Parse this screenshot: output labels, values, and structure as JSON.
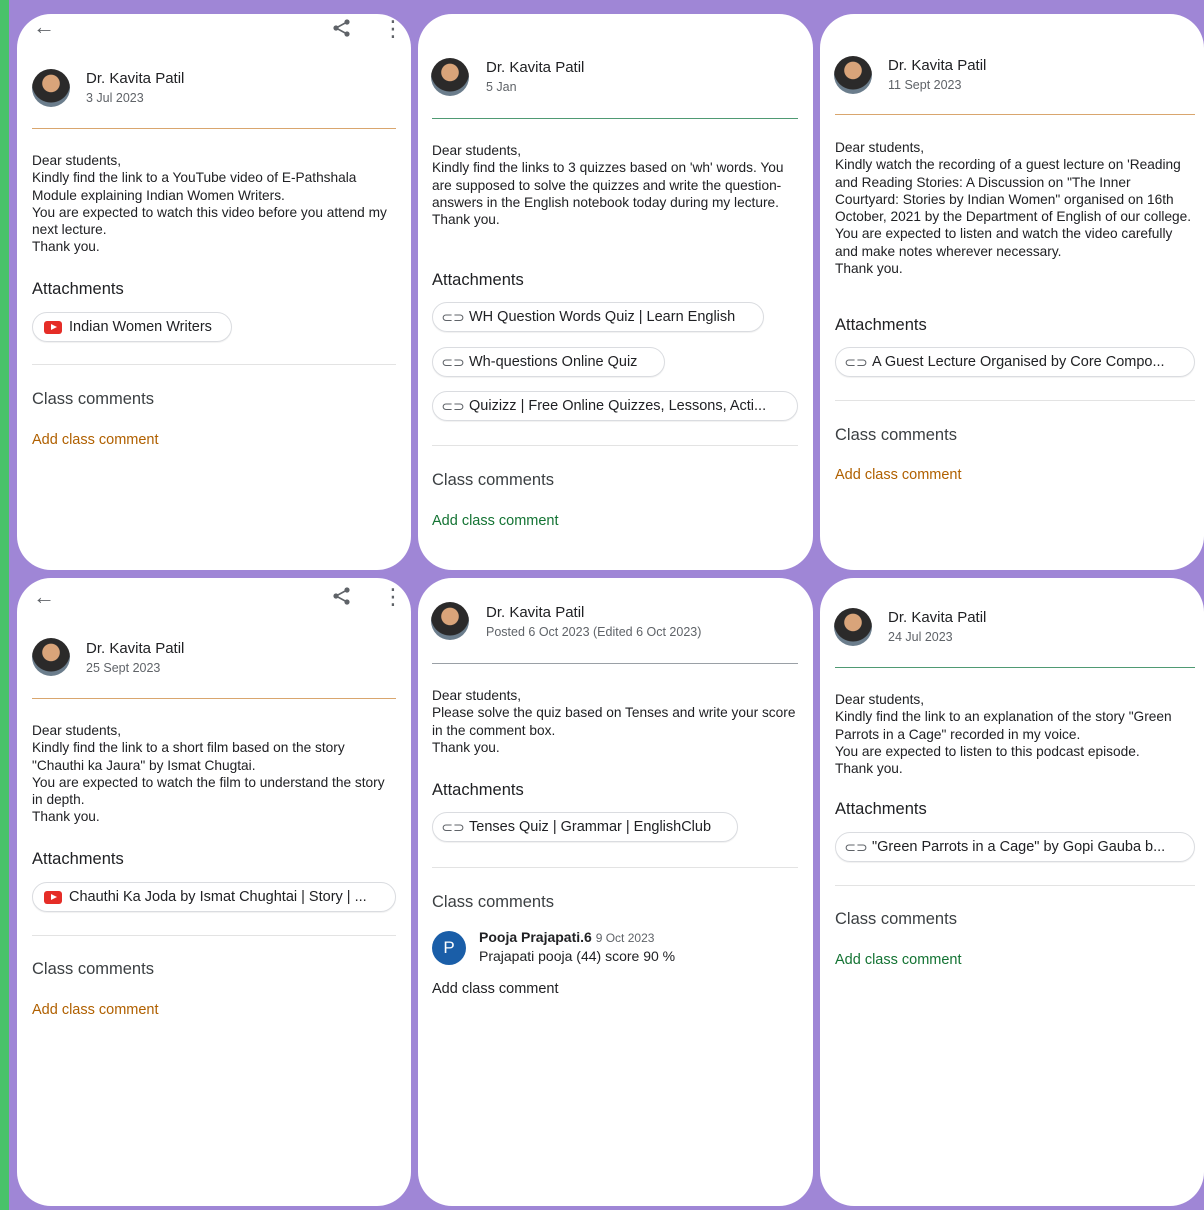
{
  "teacher": "Dr. Kavita Patil",
  "labels": {
    "attachments": "Attachments",
    "class_comments": "Class comments",
    "add_class_comment": "Add class comment"
  },
  "icons": {
    "back": "←",
    "share": "share-icon",
    "more": "⋮",
    "link": "⊂⊃"
  },
  "colors": {
    "background": "#9f86d6",
    "orange_accent": "#b06000",
    "green_accent": "#137333",
    "youtube_red": "#e52d27"
  },
  "posts": [
    {
      "date": "3 Jul 2023",
      "body": "Dear students,\nKindly find the link to a YouTube video of E-Pathshala Module explaining Indian Women Writers.\nYou are expected to watch this video before you attend my next lecture.\nThank you.",
      "attachments": [
        "Indian Women Writers"
      ]
    },
    {
      "date": "5 Jan",
      "body": "Dear students,\nKindly find the links to 3 quizzes based on 'wh' words. You are supposed to solve the quizzes and write the question-answers in the English notebook today during my lecture.\nThank you.",
      "attachments": [
        "WH Question Words Quiz | Learn English",
        "Wh-questions Online Quiz",
        "Quizizz | Free Online Quizzes, Lessons, Acti..."
      ]
    },
    {
      "date": "11 Sept 2023",
      "body": "Dear students,\nKindly watch the recording of a guest lecture on 'Reading and Reading Stories: A Discussion on \"The Inner Courtyard: Stories by Indian Women\" organised on 16th October, 2021 by the Department of English of our college.\nYou are expected to listen and watch the video carefully and make notes wherever necessary.\nThank you.",
      "attachments": [
        "A Guest Lecture Organised by Core Compo..."
      ]
    },
    {
      "date": "25 Sept 2023",
      "body": "Dear students,\nKindly find the link to a short film based on the story \"Chauthi ka Jaura\" by Ismat Chugtai.\nYou are expected to watch the film to understand the story in depth.\nThank you.",
      "attachments": [
        "Chauthi Ka Joda by Ismat Chughtai | Story | ..."
      ]
    },
    {
      "date": "Posted 6 Oct 2023 (Edited 6 Oct 2023)",
      "body": "Dear students,\nPlease solve the quiz based on Tenses and write your score in the comment box.\nThank you.",
      "attachments": [
        "Tenses Quiz | Grammar | EnglishClub"
      ],
      "comment": {
        "initial": "P",
        "author": "Pooja Prajapati.6",
        "time": "9 Oct 2023",
        "text": "Prajapati pooja (44)  score 90 %"
      }
    },
    {
      "date": "24 Jul 2023",
      "body": "Dear students,\nKindly find the link to an explanation of the story \"Green Parrots in a Cage\" recorded in my voice.\nYou are expected to listen to this podcast episode.\nThank you.",
      "attachments": [
        "\"Green Parrots in a Cage\" by Gopi Gauba b..."
      ]
    }
  ]
}
